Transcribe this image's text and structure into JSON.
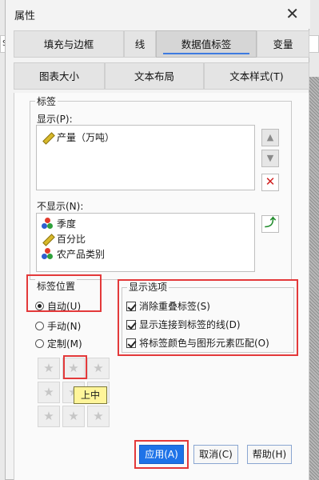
{
  "window": {
    "title": "属性",
    "close_label": "✕"
  },
  "background": {
    "left_fragment": "Sa"
  },
  "tabs_row1": [
    {
      "label": "填充与边框",
      "active": false
    },
    {
      "label": "线",
      "active": false
    },
    {
      "label": "数据值标签",
      "active": true
    },
    {
      "label": "变量",
      "active": false
    }
  ],
  "tabs_row2": [
    {
      "label": "图表大小"
    },
    {
      "label": "文本布局"
    },
    {
      "label": "文本样式(T)"
    }
  ],
  "labels_group": {
    "title": "标签",
    "shown_label": "显示(P):",
    "shown_items": [
      {
        "label": "产量（万吨）",
        "icon": "ruler-icon"
      }
    ],
    "hidden_label": "不显示(N):",
    "hidden_items": [
      {
        "label": "季度",
        "icon": "category-balls-icon"
      },
      {
        "label": "百分比",
        "icon": "ruler-icon"
      },
      {
        "label": "农产品类别",
        "icon": "category-balls-icon"
      }
    ],
    "up_arrow": "▲",
    "down_arrow": "▼",
    "remove": "✕",
    "move_back": "⤴"
  },
  "position_group": {
    "title": "标签位置",
    "options": [
      {
        "label": "自动(U)",
        "selected": true
      },
      {
        "label": "手动(N)",
        "selected": false
      },
      {
        "label": "定制(M)",
        "selected": false
      }
    ],
    "tooltip": "上中",
    "star_glyph": "★"
  },
  "display_options": {
    "title": "显示选项",
    "checks": [
      {
        "label": "消除重叠标签(S)",
        "checked": true
      },
      {
        "label": "显示连接到标签的线(D)",
        "checked": true
      },
      {
        "label": "将标签颜色与图形元素匹配(O)",
        "checked": true
      }
    ]
  },
  "footer": {
    "apply": "应用(A)",
    "cancel": "取消(C)",
    "help": "帮助(H)"
  },
  "colors": {
    "accent": "#1e73e8",
    "highlight": "#e3393a",
    "tooltip_bg": "#fff59a"
  }
}
